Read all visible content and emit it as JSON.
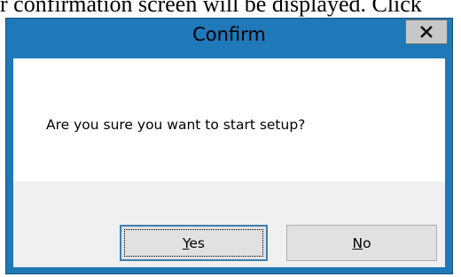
{
  "background_text": "r confirmation screen will be displayed. Click",
  "dialog": {
    "title": "Confirm",
    "close_icon": "close-x-icon",
    "message": "Are you sure you want to start setup?",
    "buttons": {
      "yes": {
        "mnemonic": "Y",
        "rest": "es"
      },
      "no": {
        "mnemonic": "N",
        "rest": "o"
      }
    }
  },
  "colors": {
    "frame": "#1f78b8",
    "close_button": "#c7c7c7",
    "button_face": "#e1e1e1",
    "focus_border": "#3c7fb1"
  }
}
